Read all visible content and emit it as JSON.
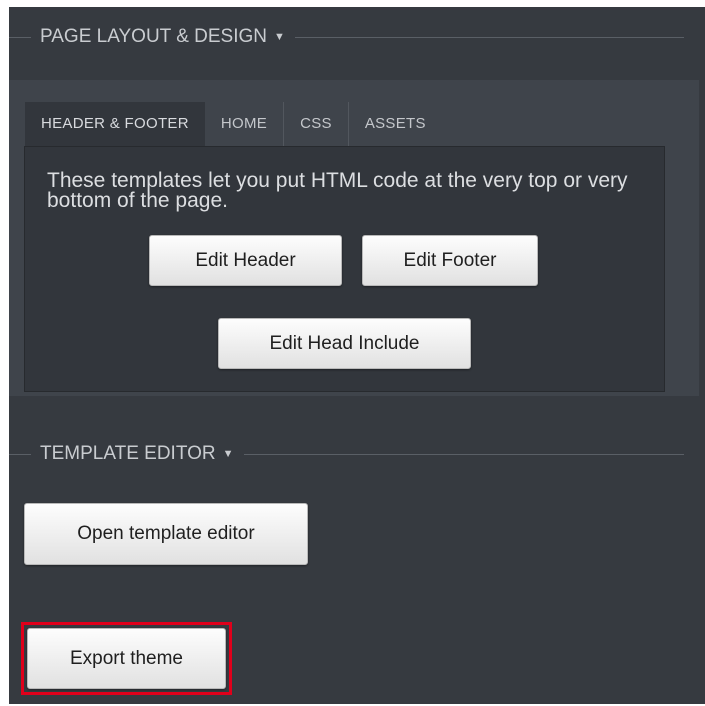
{
  "page_layout": {
    "title": "PAGE LAYOUT & DESIGN",
    "tabs": [
      {
        "label": "HEADER & FOOTER",
        "active": true
      },
      {
        "label": "HOME",
        "active": false
      },
      {
        "label": "CSS",
        "active": false
      },
      {
        "label": "ASSETS",
        "active": false
      }
    ],
    "description": "These templates let you put HTML code at the very top or very bottom of the page.",
    "edit_header_label": "Edit Header",
    "edit_footer_label": "Edit Footer",
    "edit_head_include_label": "Edit Head Include"
  },
  "template_editor": {
    "title": "TEMPLATE EDITOR",
    "open_label": "Open template editor"
  },
  "export": {
    "label": "Export theme",
    "highlight_color": "#e0001b"
  },
  "icons": {
    "caret": "caret-down-icon"
  }
}
